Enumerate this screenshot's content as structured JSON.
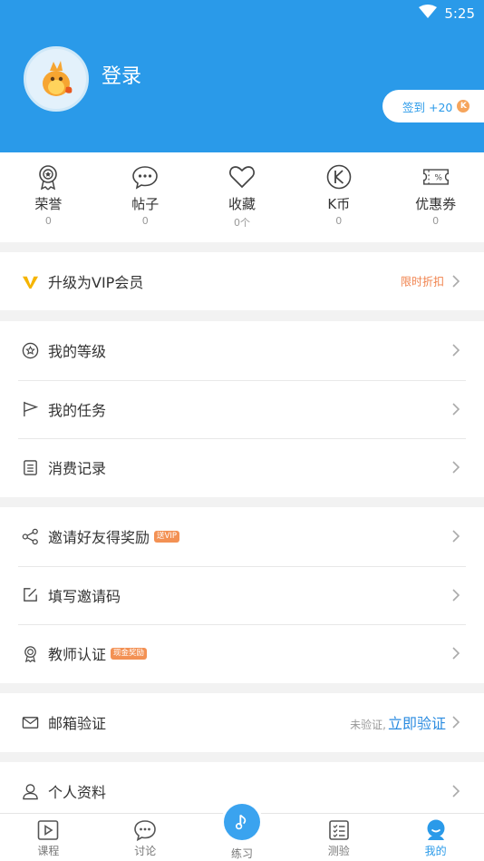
{
  "status": {
    "time": "5:25"
  },
  "header": {
    "login_text": "登录",
    "checkin_label": "签到 +20",
    "checkin_badge": "K"
  },
  "stats": [
    {
      "icon": "medal-icon",
      "label": "荣誉",
      "value": "0"
    },
    {
      "icon": "chat-bubble-icon",
      "label": "帖子",
      "value": "0"
    },
    {
      "icon": "heart-icon",
      "label": "收藏",
      "value": "0个"
    },
    {
      "icon": "kcoin-icon",
      "label": "K币",
      "value": "0"
    },
    {
      "icon": "coupon-icon",
      "label": "优惠券",
      "value": "0"
    }
  ],
  "vip": {
    "label": "升级为VIP会员",
    "note": "限时折扣"
  },
  "menu1": [
    {
      "label": "我的等级"
    },
    {
      "label": "我的任务"
    },
    {
      "label": "消费记录"
    }
  ],
  "menu2": [
    {
      "label": "邀请好友得奖励",
      "tag": "送VIP"
    },
    {
      "label": "填写邀请码"
    },
    {
      "label": "教师认证",
      "tag": "现金奖励"
    }
  ],
  "email": {
    "label": "邮箱验证",
    "status": "未验证,",
    "action": "立即验证"
  },
  "profile": {
    "label": "个人资料"
  },
  "nav": [
    {
      "label": "课程"
    },
    {
      "label": "讨论"
    },
    {
      "label": "练习"
    },
    {
      "label": "测验"
    },
    {
      "label": "我的"
    }
  ],
  "colors": {
    "primary": "#2a9ae9",
    "accent": "#f39154",
    "vip_gold": "#f5b400"
  }
}
